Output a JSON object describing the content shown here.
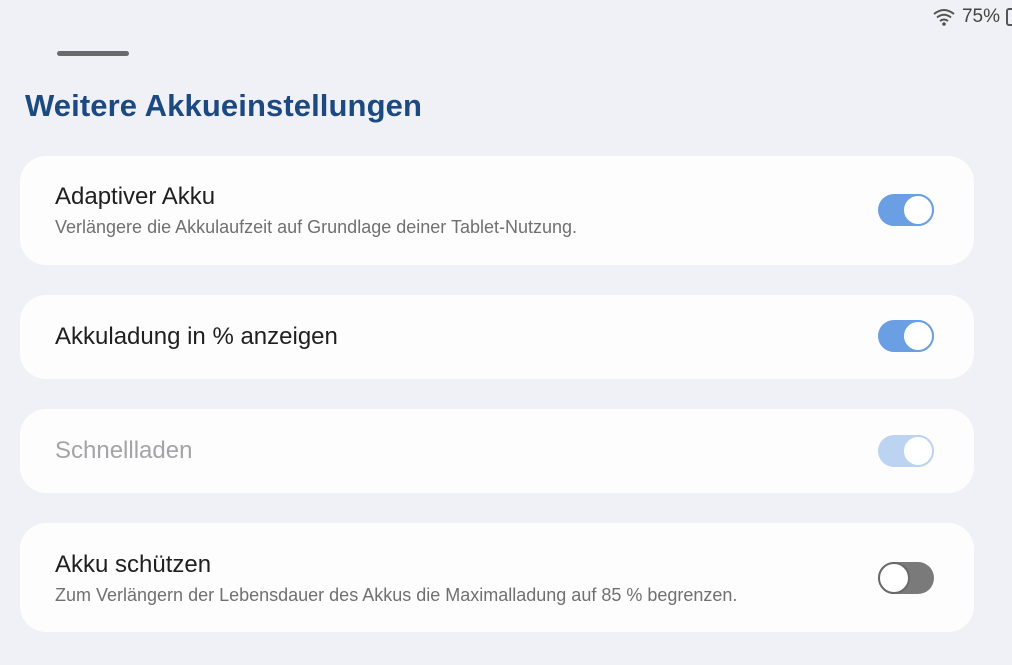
{
  "status": {
    "battery_text": "75%",
    "wifi_icon": "wifi-icon",
    "battery_icon": "battery-icon"
  },
  "page": {
    "title": "Weitere Akkueinstellungen"
  },
  "settings": [
    {
      "title": "Adaptiver Akku",
      "subtitle": "Verlängere die Akkulaufzeit auf Grundlage deiner Tablet-Nutzung.",
      "enabled": true,
      "toggle_state": "on"
    },
    {
      "title": "Akkuladung in % anzeigen",
      "subtitle": "",
      "enabled": true,
      "toggle_state": "on"
    },
    {
      "title": "Schnellladen",
      "subtitle": "",
      "enabled": false,
      "toggle_state": "on"
    },
    {
      "title": "Akku schützen",
      "subtitle": "Zum Verlängern der Lebensdauer des Akkus die Maximalladung auf 85 % begrenzen.",
      "enabled": true,
      "toggle_state": "off"
    }
  ],
  "colors": {
    "background": "#f0f0f7",
    "title": "#1c4a80",
    "toggle_on": "#6a9fe3",
    "toggle_on_disabled": "#bcd4f2",
    "toggle_off": "#7a7a7a"
  }
}
